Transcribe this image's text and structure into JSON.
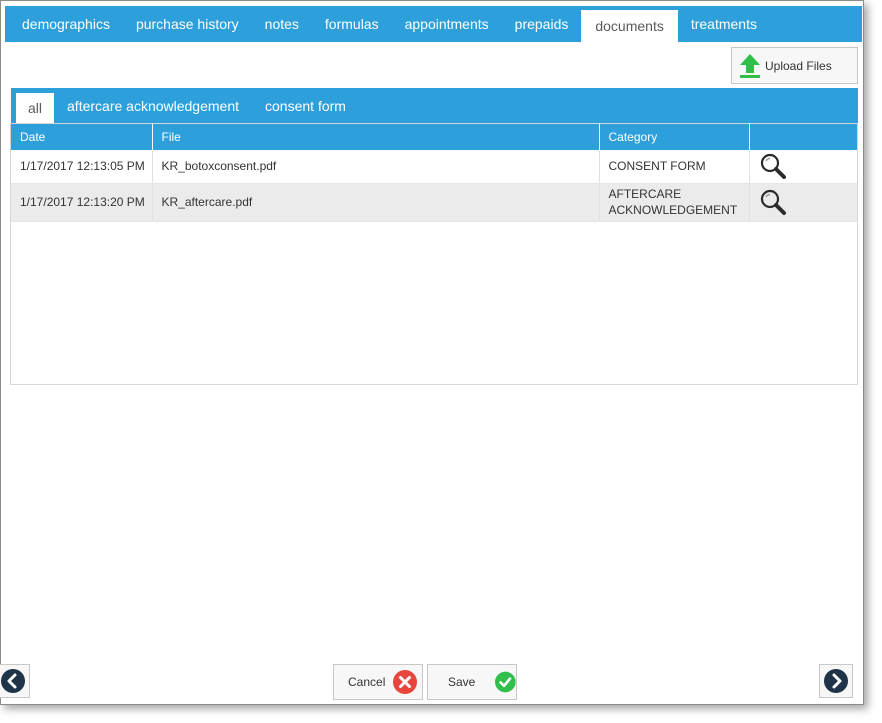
{
  "top_tabs": [
    {
      "label": "demographics"
    },
    {
      "label": "purchase history"
    },
    {
      "label": "notes"
    },
    {
      "label": "formulas"
    },
    {
      "label": "appointments"
    },
    {
      "label": "prepaids"
    },
    {
      "label": "documents",
      "active": true
    },
    {
      "label": "treatments"
    }
  ],
  "upload": {
    "label": "Upload Files",
    "icon": "upload-arrow-icon",
    "icon_color": "#2fbf4a"
  },
  "sub_tabs": [
    {
      "label": "all",
      "active": true
    },
    {
      "label": "aftercare acknowledgement"
    },
    {
      "label": "consent form"
    }
  ],
  "table": {
    "headers": [
      "Date",
      "File",
      "Category",
      ""
    ],
    "rows": [
      {
        "date": "1/17/2017 12:13:05 PM",
        "file": "KR_botoxconsent.pdf",
        "category": "CONSENT FORM",
        "action_icon": "magnifier-icon"
      },
      {
        "date": "1/17/2017 12:13:20 PM",
        "file": "KR_aftercare.pdf",
        "category": "AFTERCARE ACKNOWLEDGEMENT",
        "action_icon": "magnifier-icon"
      }
    ]
  },
  "footer": {
    "cancel_label": "Cancel",
    "save_label": "Save",
    "cancel_icon_color": "#e8453c",
    "save_icon_color": "#2fbf4a"
  },
  "colors": {
    "accent": "#2da0dc",
    "nav_icon": "#1f3448"
  }
}
